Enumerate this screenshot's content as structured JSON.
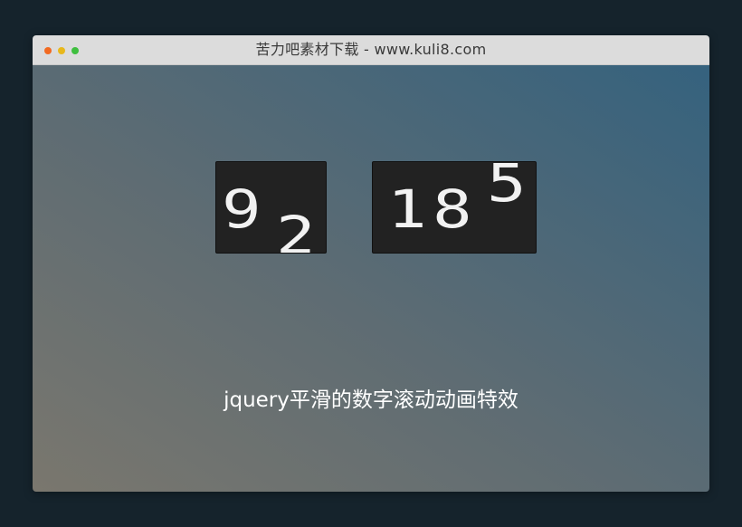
{
  "window": {
    "title": "苦力吧素材下载 - www.kuli8.com",
    "colors": {
      "close": "#f26a21",
      "minimize": "#e8b81c",
      "maximize": "#3fbf3f",
      "titlebar": "#dcdcdc",
      "page": "#15232c"
    }
  },
  "counters": [
    {
      "digits": [
        "9",
        "2"
      ],
      "rolling_previous": "1"
    },
    {
      "digits": [
        "1",
        "8",
        "5"
      ]
    }
  ],
  "caption": "jquery平滑的数字滚动动画特效"
}
